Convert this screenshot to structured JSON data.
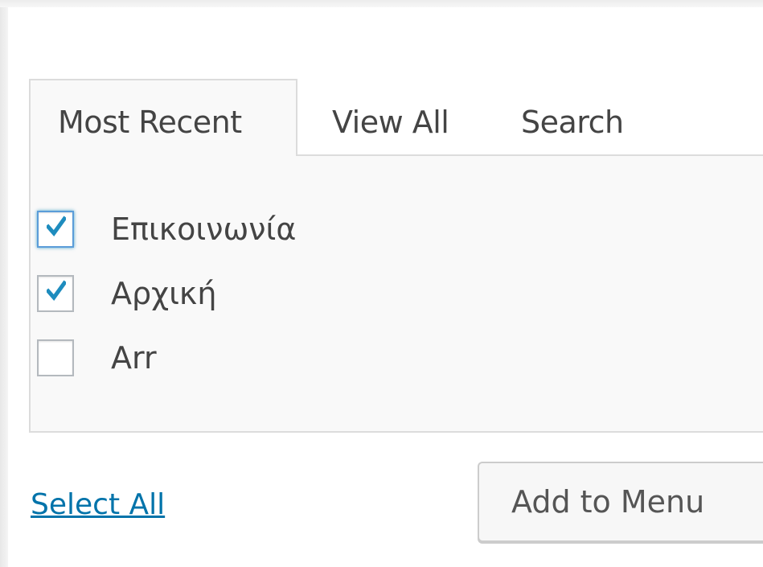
{
  "tabs": {
    "most_recent": "Most Recent",
    "view_all": "View All",
    "search": "Search"
  },
  "items": [
    {
      "label": "Επικοινωνία",
      "checked": true,
      "focused": true
    },
    {
      "label": "Αρχική",
      "checked": true,
      "focused": false
    },
    {
      "label": "Arr",
      "checked": false,
      "focused": false
    }
  ],
  "footer": {
    "select_all": "Select All",
    "add_button": "Add to Menu"
  },
  "colors": {
    "link": "#0073aa",
    "checkmark": "#1e8cbe",
    "panel_bg": "#f9f9f9",
    "border": "#dcdcdc"
  }
}
